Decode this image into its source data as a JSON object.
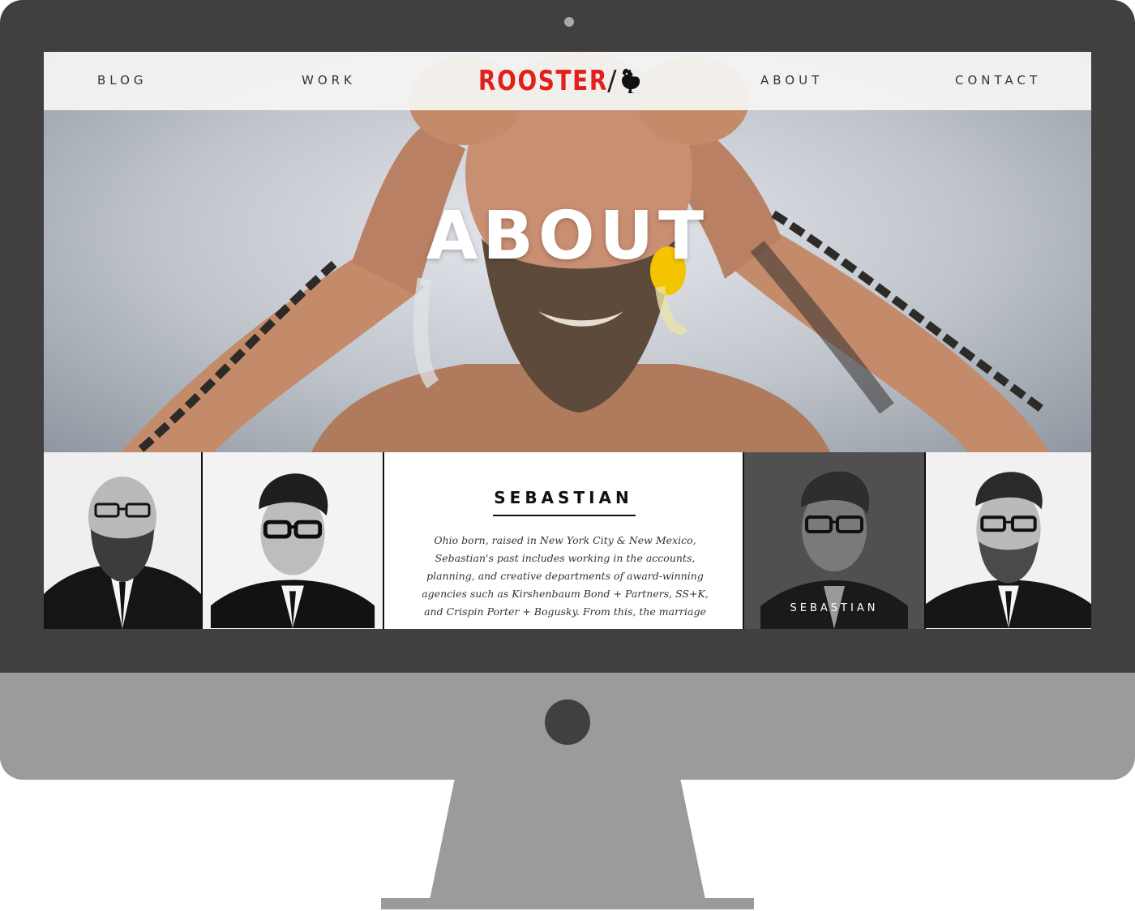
{
  "nav": {
    "blog": "BLOG",
    "work": "WORK",
    "logo": "ROOSTER",
    "logo_slash": "/",
    "about": "ABOUT",
    "contact": "CONTACT"
  },
  "hero": {
    "title": "ABOUT"
  },
  "team": {
    "bio_name": "SEBASTIAN",
    "bio_text": "Ohio born, raised in New York City & New Mexico, Sebastian's past includes working in the accounts, planning, and creative departments of award-winning agencies such as Kirshenbaum Bond + Partners, SS+K, and Crispin Porter + Bogusky. From this, the marriage",
    "hover_caption": "SEBASTIAN"
  },
  "colors": {
    "brand_red": "#e0201a",
    "monitor_frame": "#404040",
    "monitor_body": "#9b9b9b"
  }
}
